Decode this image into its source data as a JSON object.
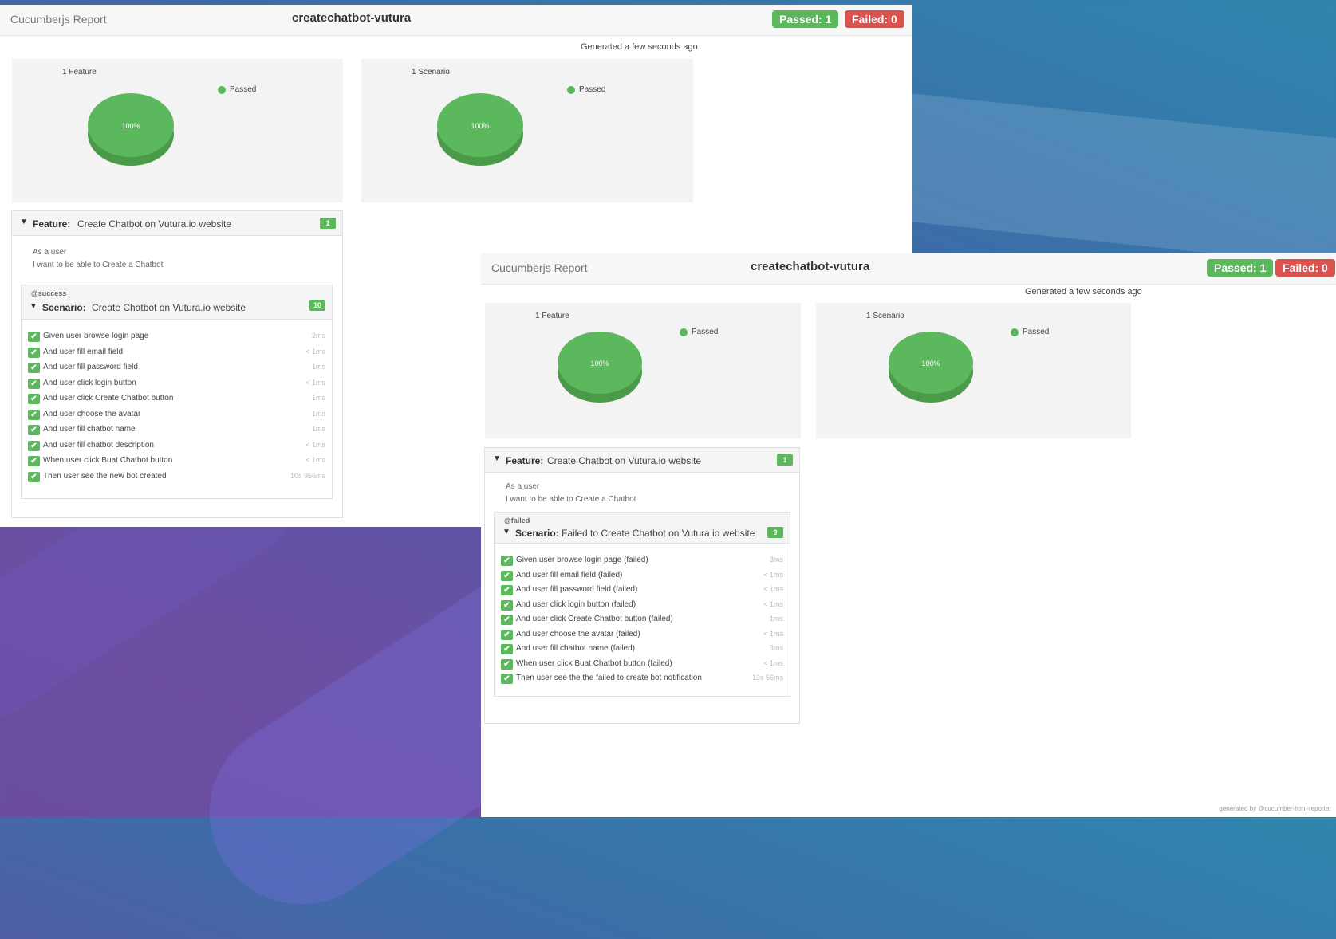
{
  "colors": {
    "passed": "#5cb85c",
    "failed": "#d9534f"
  },
  "report1": {
    "brand": "Cucumberjs Report",
    "title": "createchatbot-vutura",
    "passed_badge": "Passed: 1",
    "failed_badge": "Failed: 0",
    "generated": "Generated a few seconds ago",
    "charts": [
      {
        "title": "1 Feature",
        "legend": "Passed",
        "pie_label": "100%",
        "passed_share": 1.0
      },
      {
        "title": "1 Scenario",
        "legend": "Passed",
        "pie_label": "100%",
        "passed_share": 1.0
      }
    ],
    "feature": {
      "keyword": "Feature:",
      "title": "Create Chatbot on Vutura.io website",
      "count": "1",
      "description": [
        "As a user",
        "I want to be able to Create a Chatbot"
      ],
      "scenario": {
        "tag": "@success",
        "keyword": "Scenario:",
        "title": "Create Chatbot on Vutura.io website",
        "count": "10",
        "steps": [
          {
            "text": "Given user browse login page",
            "duration": "2ms"
          },
          {
            "text": "And user fill email field",
            "duration": "< 1ms"
          },
          {
            "text": "And user fill password field",
            "duration": "1ms"
          },
          {
            "text": "And user click login button",
            "duration": "< 1ms"
          },
          {
            "text": "And user click Create Chatbot button",
            "duration": "1ms"
          },
          {
            "text": "And user choose the avatar",
            "duration": "1ms"
          },
          {
            "text": "And user fill chatbot name",
            "duration": "1ms"
          },
          {
            "text": "And user fill chatbot description",
            "duration": "< 1ms"
          },
          {
            "text": "When user click Buat Chatbot button",
            "duration": "< 1ms"
          },
          {
            "text": "Then user see the new bot created",
            "duration": "10s 956ms"
          }
        ]
      }
    }
  },
  "report2": {
    "brand": "Cucumberjs Report",
    "title": "createchatbot-vutura",
    "passed_badge": "Passed: 1",
    "failed_badge": "Failed: 0",
    "generated": "Generated a few seconds ago",
    "charts": [
      {
        "title": "1 Feature",
        "legend": "Passed",
        "pie_label": "100%",
        "passed_share": 1.0
      },
      {
        "title": "1 Scenario",
        "legend": "Passed",
        "pie_label": "100%",
        "passed_share": 1.0
      }
    ],
    "feature": {
      "keyword": "Feature:",
      "title": "Create Chatbot on Vutura.io website",
      "count": "1",
      "description": [
        "As a user",
        "I want to be able to Create a Chatbot"
      ],
      "scenario": {
        "tag": "@failed",
        "keyword": "Scenario:",
        "title": "Failed to Create Chatbot on Vutura.io website",
        "count": "9",
        "steps": [
          {
            "text": "Given user browse login page (failed)",
            "duration": "3ms"
          },
          {
            "text": "And user fill email field (failed)",
            "duration": "< 1ms"
          },
          {
            "text": "And user fill password field (failed)",
            "duration": "< 1ms"
          },
          {
            "text": "And user click login button (failed)",
            "duration": "< 1ms"
          },
          {
            "text": "And user click Create Chatbot button (failed)",
            "duration": "1ms"
          },
          {
            "text": "And user choose the avatar (failed)",
            "duration": "< 1ms"
          },
          {
            "text": "And user fill chatbot name (failed)",
            "duration": "3ms"
          },
          {
            "text": "When user click Buat Chatbot button (failed)",
            "duration": "< 1ms"
          },
          {
            "text": "Then user see the the failed to create bot notification",
            "duration": "13s 56ms"
          }
        ]
      }
    },
    "footer": "generated by @cucumber-html-reporter"
  }
}
